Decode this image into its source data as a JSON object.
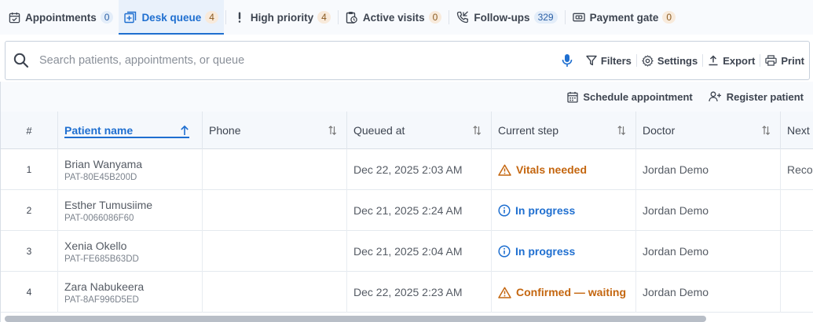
{
  "tabs": [
    {
      "label": "Appointments",
      "count": "0",
      "icon": "calendar-check-icon",
      "badge": "blue"
    },
    {
      "label": "Desk queue",
      "count": "4",
      "icon": "queue-icon",
      "badge": "orange",
      "active": true
    },
    {
      "label": "High priority",
      "count": "4",
      "icon": "exclamation-icon",
      "badge": "orange"
    },
    {
      "label": "Active visits",
      "count": "0",
      "icon": "clipboard-clock-icon",
      "badge": "orange"
    },
    {
      "label": "Follow-ups",
      "count": "329",
      "icon": "phone-callback-icon",
      "badge": "blue"
    },
    {
      "label": "Payment gate",
      "count": "0",
      "icon": "payment-icon",
      "badge": "orange"
    }
  ],
  "search": {
    "placeholder": "Search patients, appointments, or queue",
    "value": ""
  },
  "toolbar": {
    "filters": "Filters",
    "settings": "Settings",
    "export": "Export",
    "print": "Print"
  },
  "actions": {
    "schedule": "Schedule appointment",
    "register": "Register patient"
  },
  "columns": {
    "num": "#",
    "patient": "Patient name",
    "phone": "Phone",
    "queued": "Queued at",
    "step": "Current step",
    "doctor": "Doctor",
    "next": "Next"
  },
  "rows": [
    {
      "num": "1",
      "name": "Brian Wanyama",
      "id": "PAT-80E45B200D",
      "phone": "",
      "queued": "Dec 22, 2025 2:03 AM",
      "step": "Vitals needed",
      "step_type": "warn",
      "doctor": "Jordan Demo",
      "next": "Reco"
    },
    {
      "num": "2",
      "name": "Esther Tumusiime",
      "id": "PAT-0066086F60",
      "phone": "",
      "queued": "Dec 21, 2025 2:24 AM",
      "step": "In progress",
      "step_type": "info",
      "doctor": "Jordan Demo",
      "next": ""
    },
    {
      "num": "3",
      "name": "Xenia Okello",
      "id": "PAT-FE685B63DD",
      "phone": "",
      "queued": "Dec 21, 2025 2:04 AM",
      "step": "In progress",
      "step_type": "info",
      "doctor": "Jordan Demo",
      "next": ""
    },
    {
      "num": "4",
      "name": "Zara Nabukeera",
      "id": "PAT-8AF996D5ED",
      "phone": "",
      "queued": "Dec 22, 2025 2:23 AM",
      "step": "Confirmed — waiting",
      "step_type": "warn",
      "doctor": "Jordan Demo",
      "next": ""
    }
  ],
  "colors": {
    "accent": "#1f6fd0",
    "warning": "#c4660f"
  }
}
